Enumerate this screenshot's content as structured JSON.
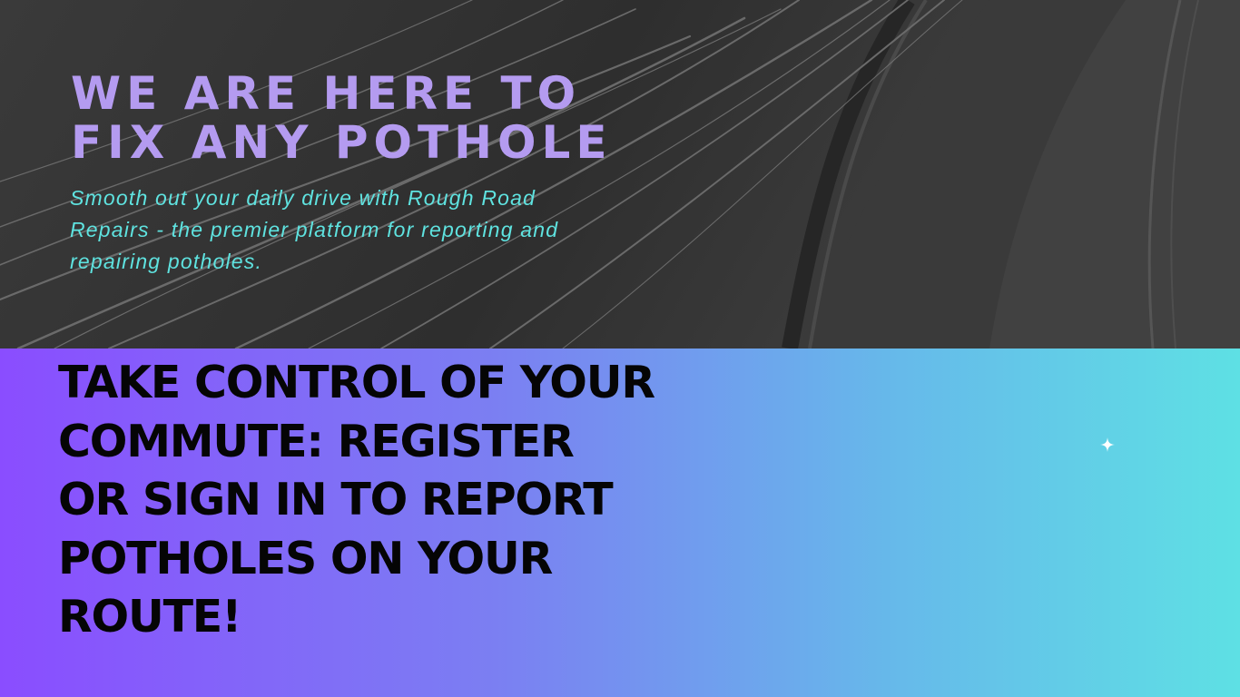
{
  "hero": {
    "title_line1": "WE ARE HERE TO",
    "title_line2": "FIX ANY POTHOLE",
    "subtitle": "Smooth out your daily drive with Rough Road Repairs - the premier platform for reporting and repairing potholes."
  },
  "cta": {
    "heading": "TAKE CONTROL OF YOUR COMMUTE: REGISTER OR SIGN IN TO REPORT POTHOLES ON YOUR ROUTE!"
  },
  "icons": {
    "sparkle": "sparkle-icon",
    "background": "highway-light-trails-photo"
  },
  "colors": {
    "title": "#b49bf0",
    "subtitle": "#5fe3e0",
    "gradient_start": "#8a4dff",
    "gradient_end": "#5ee0e4",
    "heading": "#050505"
  }
}
